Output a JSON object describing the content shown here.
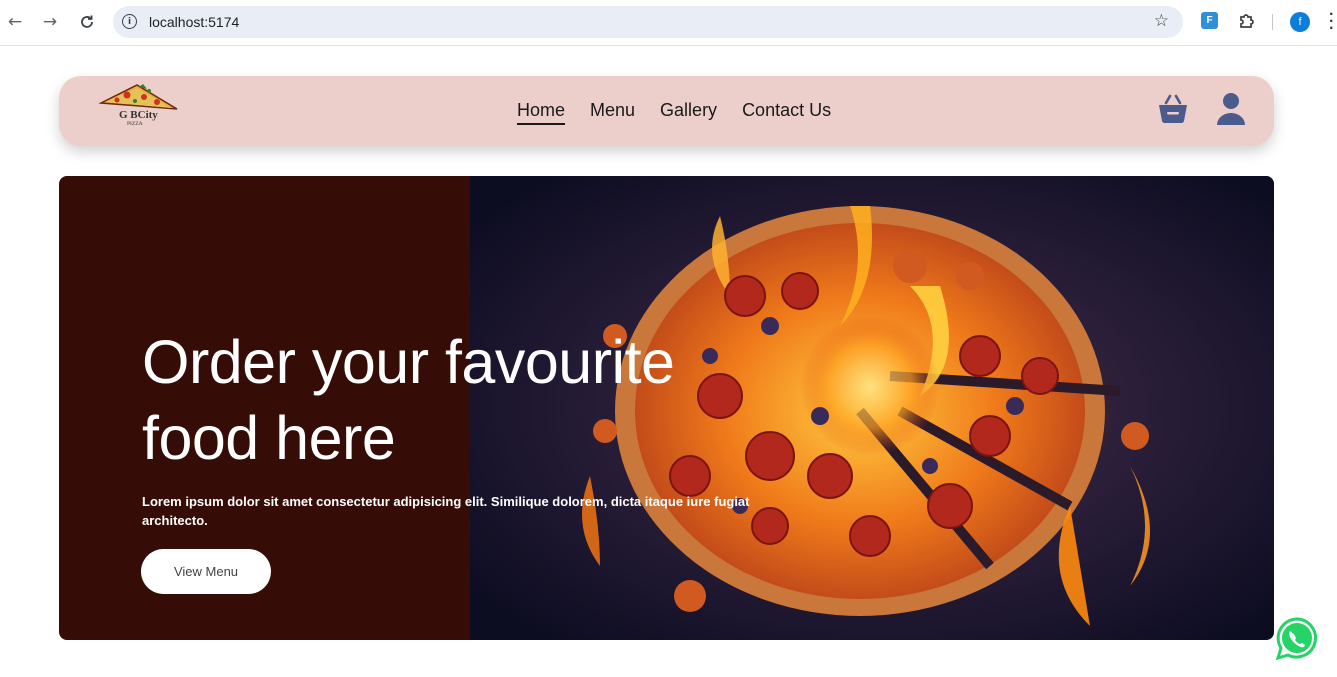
{
  "browser": {
    "back_icon": "arrow-left-icon",
    "forward_icon": "arrow-right-icon",
    "reload_icon": "reload-icon",
    "url": "localhost:5174",
    "extension_label": "F",
    "profile_initial": "f"
  },
  "header": {
    "logo_text": "G BCity",
    "logo_subtext": "PIZZA",
    "nav": [
      {
        "label": "Home",
        "active": true
      },
      {
        "label": "Menu"
      },
      {
        "label": "Gallery"
      },
      {
        "label": "Contact Us"
      }
    ]
  },
  "hero": {
    "title": "Order your favourite food here",
    "subtitle": "Lorem ipsum dolor sit amet consectetur adipisicing elit. Similique dolorem, dicta itaque iure fugiat architecto.",
    "button_label": "View Menu"
  },
  "colors": {
    "header_bg": "#eccfcb",
    "hero_bg": "#360c06",
    "icon_blue": "#4a5b8c",
    "whatsapp_green": "#25d366"
  }
}
